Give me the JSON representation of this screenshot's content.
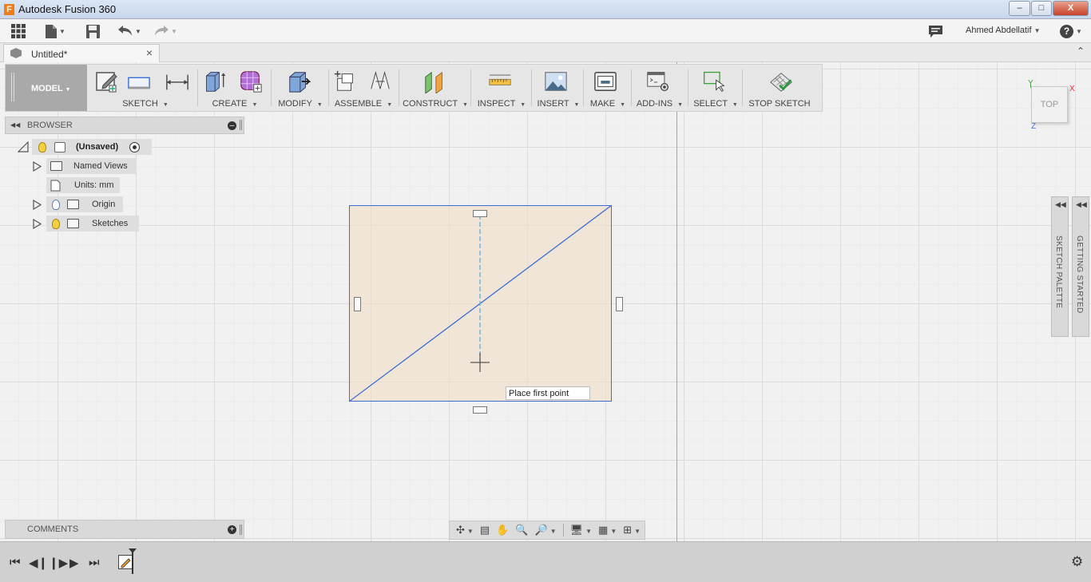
{
  "window": {
    "title": "Autodesk Fusion 360",
    "app_icon": "F",
    "minimize": "–",
    "restore": "□",
    "close": "X"
  },
  "menubar": {
    "user_name": "Ahmed Abdellatif",
    "icons": [
      "app-grid-icon",
      "file-icon",
      "save-icon",
      "undo-icon",
      "redo-icon",
      "comments-icon",
      "help-icon"
    ],
    "help": "?"
  },
  "tabs": [
    {
      "label": "Untitled*",
      "close": "×"
    }
  ],
  "toolbar": {
    "workspace": "MODEL",
    "groups": [
      {
        "label": "SKETCH"
      },
      {
        "label": "CREATE"
      },
      {
        "label": "MODIFY"
      },
      {
        "label": "ASSEMBLE"
      },
      {
        "label": "CONSTRUCT"
      },
      {
        "label": "INSPECT"
      },
      {
        "label": "INSERT"
      },
      {
        "label": "MAKE"
      },
      {
        "label": "ADD-INS"
      },
      {
        "label": "SELECT"
      },
      {
        "label": "STOP SKETCH"
      }
    ]
  },
  "viewcube": {
    "face": "TOP",
    "axis_x": "X",
    "axis_y": "Y",
    "axis_z": "Z"
  },
  "browser": {
    "title": "BROWSER",
    "items": [
      {
        "label": "(Unsaved)"
      },
      {
        "label": "Named Views"
      },
      {
        "label": "Units: mm"
      },
      {
        "label": "Origin"
      },
      {
        "label": "Sketches"
      }
    ]
  },
  "canvas": {
    "tooltip": "Place first point"
  },
  "right_panels": [
    {
      "label": "SKETCH PALETTE"
    },
    {
      "label": "GETTING STARTED"
    }
  ],
  "comments": {
    "title": "COMMENTS"
  },
  "colors": {
    "sketch_line": "#3b6fd4",
    "sketch_fill": "#f2dec6",
    "axis_green": "#6cc96c",
    "model_button": "#a9a9a9"
  }
}
